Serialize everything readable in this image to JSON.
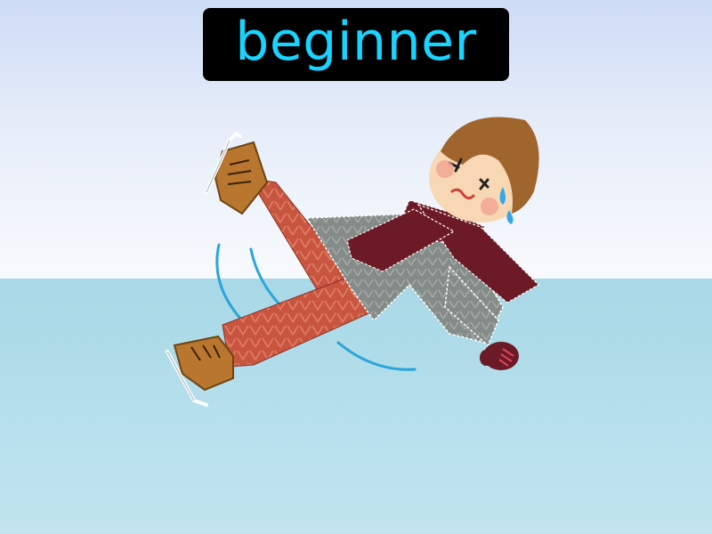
{
  "flashcard": {
    "word": "beginner"
  },
  "colors": {
    "banner_background": "#000000",
    "word_color": "#19d3ff",
    "sky": "#e6edf9",
    "ice": "#b7e0ec",
    "pants": "#c8553f",
    "sweater": "#8e9490",
    "scarf": "#6b1a26",
    "boots": "#b8762e",
    "hair": "#a0642d",
    "motion_lines": "#2aa6d9"
  },
  "illustration": {
    "subject_icon": "falling-ice-skater-icon",
    "motion_icon": "motion-lines-icon"
  }
}
